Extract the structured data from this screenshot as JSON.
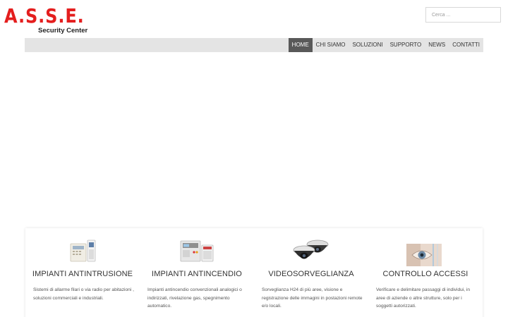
{
  "brand": {
    "logo_text": "A.S.S.E.",
    "tagline": "Security Center",
    "accent_color": "#e41e1e"
  },
  "search": {
    "placeholder": "Cerca ..."
  },
  "nav": {
    "active_bg": "#595959",
    "items": [
      {
        "label": "HOME",
        "active": true
      },
      {
        "label": "CHI SIAMO",
        "active": false
      },
      {
        "label": "SOLUZIONI",
        "active": false
      },
      {
        "label": "SUPPORTO",
        "active": false
      },
      {
        "label": "NEWS",
        "active": false
      },
      {
        "label": "CONTATTI",
        "active": false
      }
    ]
  },
  "features": [
    {
      "icon": "alarm-panel-image",
      "title": "IMPIANTI ANTINTRUSIONE",
      "description": "Sistemi di allarme filari o via radio per abitazioni , soluzioni commerciali e industriali."
    },
    {
      "icon": "fire-panel-image",
      "title": "IMPIANTI ANTINCENDIO",
      "description": "Impianti antincendio convenzionali analogici o indirizzati, rivelazione gas, spegnimento automatico."
    },
    {
      "icon": "dome-cameras-image",
      "title": "VIDEOSORVEGLIANZA",
      "description": "Sorveglianza H24 di più aree, visione e registrazione delle immagini in postazioni remote e/o locali."
    },
    {
      "icon": "eye-scan-image",
      "title": "CONTROLLO ACCESSI",
      "description": "Verificare e delimitare passaggi di individui, in aree di aziende o altre strutture, solo per i soggetti autorizzati."
    }
  ]
}
